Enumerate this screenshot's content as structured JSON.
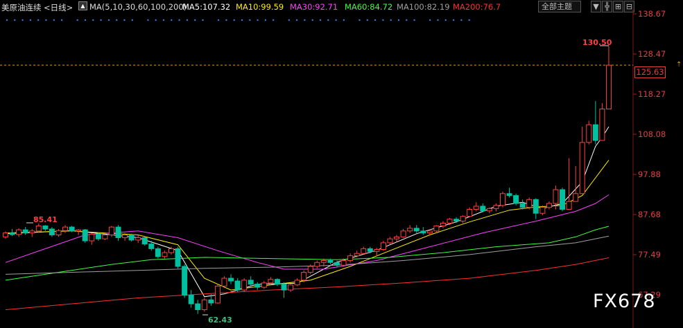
{
  "header": {
    "instrument": "美原油连续",
    "period": "<日线>",
    "ma_params": "MA(5,10,30,60,100,200)",
    "ma5": "MA5:107.32",
    "ma10": "MA10:99.59",
    "ma30": "MA30:92.71",
    "ma60": "MA60:84.72",
    "ma100": "MA100:82.19",
    "ma200": "MA200:76.7",
    "theme_select": "全部主题",
    "theme_caret": "▼",
    "btn1": "╬",
    "btn2": "⊞",
    "btn3": "⊟"
  },
  "colors": {
    "up": "#ff4040",
    "down": "#00c0a0",
    "ma5": "#ffffff",
    "ma10": "#ffee00",
    "ma30": "#ff40ff",
    "ma60": "#40ff40",
    "ma100": "#a0a0a0",
    "ma200": "#ff3030"
  },
  "current_price": "125.63",
  "labels": {
    "high": "130.50",
    "peak_left": "85.41",
    "low": "62.43"
  },
  "watermark": "FX678",
  "chart_data": {
    "type": "candlestick",
    "title": "美原油连续 日线",
    "ylim": [
      67.29,
      138.67
    ],
    "y_ticks": [
      "138.67",
      "128.47",
      "118.27",
      "108.08",
      "97.88",
      "87.68",
      "77.49",
      "67.29"
    ],
    "candles": [
      [
        82.0,
        83.4,
        81.5,
        83.0
      ],
      [
        83.0,
        84.0,
        82.2,
        82.6
      ],
      [
        82.6,
        84.2,
        82.0,
        83.8
      ],
      [
        83.8,
        84.5,
        82.5,
        83.0
      ],
      [
        83.0,
        84.0,
        82.0,
        83.5
      ],
      [
        83.5,
        85.41,
        83.0,
        84.8
      ],
      [
        84.8,
        85.0,
        83.5,
        84.0
      ],
      [
        84.0,
        84.5,
        82.0,
        82.5
      ],
      [
        82.5,
        84.0,
        82.0,
        83.6
      ],
      [
        83.6,
        85.0,
        83.0,
        84.5
      ],
      [
        84.5,
        84.8,
        83.2,
        83.5
      ],
      [
        83.5,
        84.0,
        82.5,
        83.8
      ],
      [
        83.8,
        84.0,
        80.5,
        81.0
      ],
      [
        81.0,
        83.0,
        80.0,
        82.7
      ],
      [
        82.7,
        83.2,
        81.0,
        81.5
      ],
      [
        81.5,
        82.8,
        81.2,
        82.5
      ],
      [
        82.5,
        84.8,
        82.0,
        84.5
      ],
      [
        84.5,
        85.0,
        81.0,
        81.8
      ],
      [
        81.8,
        83.0,
        81.0,
        82.5
      ],
      [
        82.5,
        82.8,
        80.8,
        81.2
      ],
      [
        81.2,
        82.5,
        80.5,
        81.8
      ],
      [
        81.8,
        82.0,
        79.8,
        80.2
      ],
      [
        80.2,
        81.0,
        78.5,
        79.0
      ],
      [
        79.0,
        79.5,
        76.5,
        77.0
      ],
      [
        77.0,
        78.5,
        76.5,
        78.0
      ],
      [
        78.0,
        79.5,
        77.5,
        79.0
      ],
      [
        79.0,
        79.5,
        74.0,
        74.5
      ],
      [
        74.5,
        75.0,
        66.5,
        67.2
      ],
      [
        67.2,
        68.5,
        64.0,
        65.0
      ],
      [
        65.0,
        66.0,
        62.43,
        63.5
      ],
      [
        63.5,
        66.5,
        63.0,
        66.0
      ],
      [
        66.0,
        67.5,
        64.5,
        65.2
      ],
      [
        65.2,
        70.0,
        65.0,
        69.5
      ],
      [
        69.5,
        72.0,
        69.0,
        71.5
      ],
      [
        71.5,
        72.5,
        70.0,
        70.8
      ],
      [
        70.8,
        71.5,
        68.0,
        68.5
      ],
      [
        68.5,
        71.5,
        68.0,
        71.0
      ],
      [
        71.0,
        72.0,
        69.5,
        70.0
      ],
      [
        70.0,
        70.5,
        68.5,
        69.2
      ],
      [
        69.2,
        70.8,
        68.8,
        70.3
      ],
      [
        70.3,
        71.8,
        70.0,
        71.2
      ],
      [
        71.2,
        71.5,
        69.5,
        70.0
      ],
      [
        70.0,
        70.5,
        66.5,
        68.5
      ],
      [
        68.5,
        70.0,
        68.0,
        69.8
      ],
      [
        69.8,
        71.5,
        69.5,
        71.0
      ],
      [
        71.0,
        73.5,
        70.5,
        73.0
      ],
      [
        73.0,
        75.0,
        72.5,
        74.5
      ],
      [
        74.5,
        76.0,
        74.0,
        75.5
      ],
      [
        75.5,
        76.5,
        74.5,
        76.0
      ],
      [
        76.0,
        76.5,
        75.0,
        75.5
      ],
      [
        75.5,
        76.0,
        74.2,
        74.8
      ],
      [
        74.8,
        76.5,
        74.5,
        76.0
      ],
      [
        76.0,
        77.8,
        75.5,
        77.2
      ],
      [
        77.2,
        78.5,
        76.8,
        77.8
      ],
      [
        77.8,
        79.5,
        77.5,
        79.0
      ],
      [
        79.0,
        79.5,
        77.8,
        78.3
      ],
      [
        78.3,
        79.2,
        77.0,
        78.8
      ],
      [
        78.8,
        81.0,
        78.5,
        80.5
      ],
      [
        80.5,
        82.0,
        80.0,
        81.5
      ],
      [
        81.5,
        82.5,
        80.8,
        82.0
      ],
      [
        82.0,
        84.0,
        81.8,
        83.5
      ],
      [
        83.5,
        85.0,
        83.0,
        84.2
      ],
      [
        84.2,
        85.0,
        83.0,
        83.5
      ],
      [
        83.5,
        84.5,
        82.5,
        83.0
      ],
      [
        83.0,
        84.0,
        82.3,
        83.5
      ],
      [
        83.5,
        85.0,
        83.0,
        84.8
      ],
      [
        84.8,
        86.0,
        84.2,
        85.5
      ],
      [
        85.5,
        86.8,
        85.0,
        86.5
      ],
      [
        86.5,
        87.0,
        85.5,
        86.0
      ],
      [
        86.0,
        87.5,
        85.5,
        87.2
      ],
      [
        87.2,
        89.5,
        87.0,
        89.0
      ],
      [
        89.0,
        90.8,
        88.5,
        89.8
      ],
      [
        89.8,
        90.5,
        88.2,
        88.6
      ],
      [
        88.6,
        89.5,
        88.0,
        89.2
      ],
      [
        89.2,
        90.5,
        88.5,
        90.0
      ],
      [
        90.0,
        93.5,
        89.5,
        93.0
      ],
      [
        93.0,
        94.5,
        92.0,
        92.5
      ],
      [
        92.5,
        93.0,
        90.0,
        90.5
      ],
      [
        90.5,
        91.5,
        89.0,
        89.5
      ],
      [
        89.5,
        92.0,
        89.0,
        91.5
      ],
      [
        91.5,
        91.8,
        86.5,
        88.0
      ],
      [
        88.0,
        90.0,
        87.5,
        89.5
      ],
      [
        89.5,
        91.0,
        89.0,
        90.5
      ],
      [
        90.5,
        95.0,
        89.0,
        94.0
      ],
      [
        94.0,
        94.5,
        88.5,
        89.0
      ],
      [
        89.0,
        102.0,
        89.5,
        91.0
      ],
      [
        91.0,
        100.0,
        91.5,
        93.0
      ],
      [
        93.0,
        110.0,
        93.0,
        106.0
      ],
      [
        106.0,
        111.5,
        105.5,
        110.5
      ],
      [
        110.5,
        116.5,
        105.5,
        106.5
      ],
      [
        106.5,
        116.0,
        108.0,
        114.5
      ],
      [
        114.5,
        130.5,
        115.0,
        125.63
      ]
    ],
    "ma_lines": {
      "MA5": [
        [
          0,
          82.8
        ],
        [
          10,
          83.6
        ],
        [
          20,
          81.8
        ],
        [
          26,
          78.5
        ],
        [
          30,
          66.8
        ],
        [
          33,
          67.5
        ],
        [
          38,
          70.0
        ],
        [
          44,
          70.2
        ],
        [
          50,
          75.6
        ],
        [
          56,
          78.6
        ],
        [
          62,
          82.8
        ],
        [
          68,
          85.8
        ],
        [
          74,
          89.8
        ],
        [
          78,
          90.8
        ],
        [
          81,
          89.2
        ],
        [
          84,
          90.5
        ],
        [
          87,
          96.0
        ],
        [
          89,
          105.0
        ],
        [
          90,
          107.3
        ],
        [
          91,
          110.0
        ]
      ],
      "MA10": [
        [
          0,
          83.0
        ],
        [
          10,
          83.5
        ],
        [
          20,
          82.5
        ],
        [
          26,
          80.0
        ],
        [
          30,
          71.5
        ],
        [
          34,
          68.5
        ],
        [
          40,
          69.8
        ],
        [
          46,
          71.0
        ],
        [
          52,
          74.5
        ],
        [
          58,
          78.5
        ],
        [
          64,
          82.5
        ],
        [
          70,
          85.8
        ],
        [
          76,
          88.8
        ],
        [
          80,
          89.6
        ],
        [
          84,
          90.0
        ],
        [
          87,
          92.5
        ],
        [
          89,
          97.0
        ],
        [
          91,
          101.5
        ]
      ],
      "MA30": [
        [
          0,
          75.5
        ],
        [
          6,
          79.0
        ],
        [
          12,
          82.5
        ],
        [
          20,
          83.5
        ],
        [
          26,
          81.8
        ],
        [
          32,
          78.5
        ],
        [
          38,
          75.5
        ],
        [
          42,
          73.8
        ],
        [
          48,
          73.8
        ],
        [
          56,
          76.0
        ],
        [
          64,
          79.5
        ],
        [
          72,
          83.0
        ],
        [
          80,
          86.0
        ],
        [
          86,
          88.5
        ],
        [
          89,
          90.5
        ],
        [
          91,
          92.7
        ]
      ],
      "MA60": [
        [
          0,
          71.0
        ],
        [
          8,
          73.0
        ],
        [
          16,
          75.0
        ],
        [
          22,
          76.2
        ],
        [
          30,
          76.8
        ],
        [
          40,
          76.5
        ],
        [
          50,
          76.2
        ],
        [
          58,
          76.8
        ],
        [
          66,
          78.0
        ],
        [
          74,
          79.5
        ],
        [
          82,
          80.5
        ],
        [
          86,
          82.0
        ],
        [
          89,
          83.8
        ],
        [
          91,
          84.7
        ]
      ],
      "MA100": [
        [
          0,
          72.5
        ],
        [
          10,
          73.0
        ],
        [
          20,
          73.5
        ],
        [
          30,
          74.0
        ],
        [
          40,
          74.3
        ],
        [
          50,
          74.8
        ],
        [
          60,
          76.0
        ],
        [
          70,
          77.5
        ],
        [
          80,
          79.5
        ],
        [
          86,
          80.5
        ],
        [
          91,
          82.2
        ]
      ],
      "MA200": [
        [
          0,
          63.5
        ],
        [
          10,
          65.0
        ],
        [
          20,
          66.5
        ],
        [
          30,
          67.5
        ],
        [
          40,
          68.5
        ],
        [
          50,
          69.3
        ],
        [
          60,
          70.3
        ],
        [
          70,
          71.5
        ],
        [
          80,
          73.5
        ],
        [
          86,
          75.0
        ],
        [
          91,
          76.7
        ]
      ]
    }
  }
}
